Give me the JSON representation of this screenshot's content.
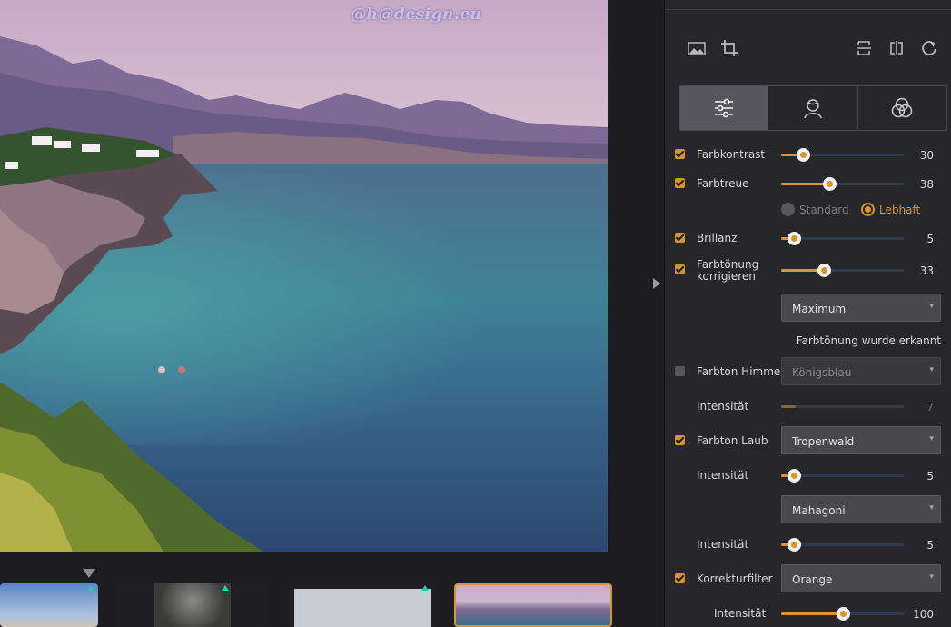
{
  "watermark": "@h@design.eu",
  "toolbar": {
    "left_icons": [
      "image-icon",
      "crop-icon"
    ],
    "right_icons": [
      "flip-vertical-icon",
      "flip-horizontal-icon",
      "rotate-icon"
    ]
  },
  "tabs": [
    {
      "icon": "sliders-icon",
      "active": true
    },
    {
      "icon": "portrait-icon",
      "active": false
    },
    {
      "icon": "color-circles-icon",
      "active": false
    }
  ],
  "adjustments": {
    "farbkontrast": {
      "label": "Farbkontrast",
      "checked": true,
      "value": "30",
      "level": 0.18
    },
    "farbtreue": {
      "label": "Farbtreue",
      "checked": true,
      "value": "38",
      "level": 0.39
    },
    "mode": {
      "standard": "Standard",
      "lebhaft": "Lebhaft",
      "selected": "Lebhaft"
    },
    "brillanz": {
      "label": "Brillanz",
      "checked": true,
      "value": "5",
      "level": 0.1
    },
    "farbtoenung": {
      "label_line1": "Farbtönung",
      "label_line2": "korrigieren",
      "checked": true,
      "value": "33",
      "level": 0.35
    },
    "farbtoenung_select": "Maximum",
    "farbtoenung_status": "Farbtönung wurde erkannt",
    "himmel": {
      "label": "Farbton Himmel",
      "checked": false,
      "select": "Königsblau"
    },
    "himmel_intensitaet": {
      "label": "Intensität",
      "value": "7",
      "level": 0.12
    },
    "laub": {
      "label": "Farbton Laub",
      "checked": true,
      "select": "Tropenwald"
    },
    "laub_intensitaet": {
      "label": "Intensität",
      "value": "5",
      "level": 0.1
    },
    "laub_select2": "Mahagoni",
    "laub_intensitaet2": {
      "label": "Intensität",
      "value": "5",
      "level": 0.1
    },
    "korrekturfilter": {
      "label": "Korrekturfilter",
      "checked": true,
      "select": "Orange"
    },
    "korrektur_intensitaet": {
      "label": "Intensität",
      "value": "100",
      "level": 0.5
    }
  },
  "colors": {
    "accent": "#d7952b",
    "panel": "#26262b",
    "background": "#1d1d21",
    "filter_tag": "#2dc7b0"
  }
}
